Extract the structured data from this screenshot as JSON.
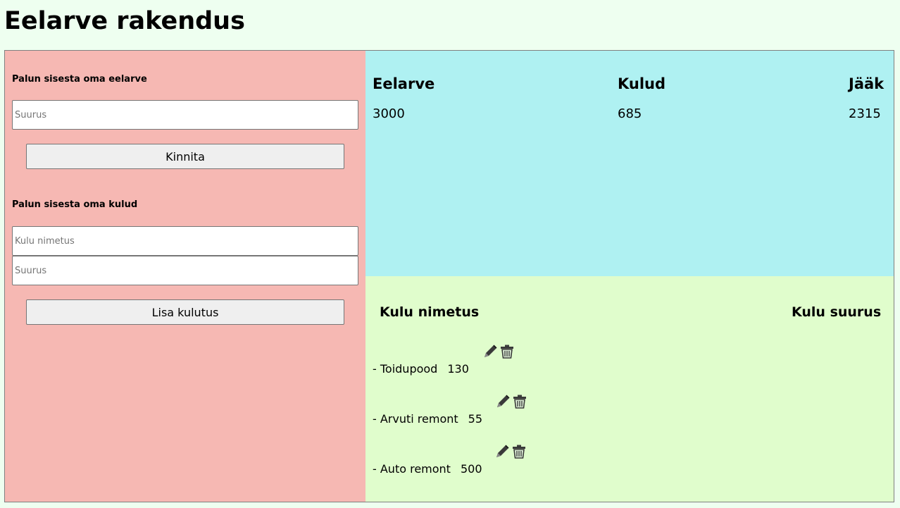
{
  "app": {
    "title": "Eelarve rakendus"
  },
  "budget_form": {
    "label": "Palun sisesta oma eelarve",
    "amount_placeholder": "Suurus",
    "confirm_label": "Kinnita"
  },
  "expense_form": {
    "label": "Palun sisesta oma kulud",
    "name_placeholder": "Kulu nimetus",
    "amount_placeholder": "Suurus",
    "add_label": "Lisa kulutus"
  },
  "summary": {
    "budget_label": "Eelarve",
    "budget_value": "3000",
    "expenses_label": "Kulud",
    "expenses_value": "685",
    "remaining_label": "Jääk",
    "remaining_value": "2315"
  },
  "expense_list": {
    "name_header": "Kulu nimetus",
    "amount_header": "Kulu suurus",
    "items": [
      {
        "name": "- Toidupood",
        "amount": "130",
        "icons": [
          "pencil-icon",
          "trash-icon"
        ]
      },
      {
        "name": "- Arvuti remont",
        "amount": "55",
        "icons": [
          "pencil-icon",
          "trash-icon"
        ]
      },
      {
        "name": "- Auto remont",
        "amount": "500",
        "icons": [
          "pencil-icon",
          "trash-icon"
        ]
      }
    ]
  },
  "colors": {
    "page_background": "#eefff0",
    "input_panel": "#f6b8b3",
    "summary_panel": "#aff1f2",
    "list_panel": "#e0fdcc"
  }
}
